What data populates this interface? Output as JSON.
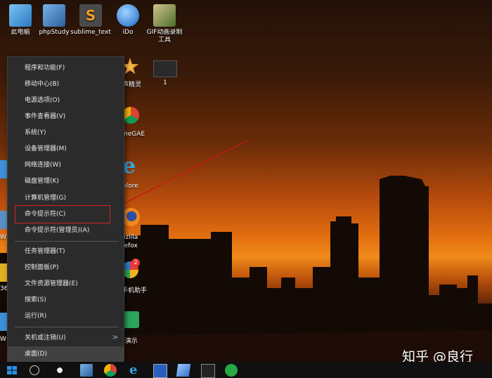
{
  "desktop": {
    "icons_top": [
      {
        "label": "此电脑",
        "color": "#3d8fd6"
      },
      {
        "label": "phpStudy",
        "color": "#3a7fc4"
      },
      {
        "label": "sublime_text",
        "color": "#444444"
      },
      {
        "label": "iDo",
        "color": "#2d7fd0"
      },
      {
        "label": "GIF动画录制",
        "label2": "工具",
        "color": "#6a8a3a"
      }
    ],
    "partial_labels": {
      "sprite": "声精灵",
      "item_1": "1",
      "chrome": "meGAE",
      "ie": "plore",
      "firefox_1": "ozilla",
      "firefox_2": "refox",
      "assistant": "手机助手",
      "demo": "0演示",
      "left_36": "36",
      "left_w1": "W",
      "left_w2": "W"
    },
    "assistant_badge": "2"
  },
  "context_menu": {
    "items": [
      {
        "label": "程序和功能(F)"
      },
      {
        "label": "移动中心(B)"
      },
      {
        "label": "电源选项(O)"
      },
      {
        "label": "事件查看器(V)"
      },
      {
        "label": "系统(Y)"
      },
      {
        "label": "设备管理器(M)"
      },
      {
        "label": "网络连接(W)"
      },
      {
        "label": "磁盘管理(K)"
      },
      {
        "label": "计算机管理(G)"
      },
      {
        "label": "命令提示符(C)"
      },
      {
        "label": "命令提示符(管理员)(A)"
      },
      {
        "label": "任务管理器(T)"
      },
      {
        "label": "控制面板(P)"
      },
      {
        "label": "文件资源管理器(E)"
      },
      {
        "label": "搜索(S)"
      },
      {
        "label": "运行(R)"
      },
      {
        "label": "关机或注销(U)",
        "submenu": ">"
      },
      {
        "label": "桌面(D)"
      }
    ]
  },
  "watermark": "知乎 @良行",
  "colors": {
    "menu_bg": "#2b2b2b",
    "highlight": "#d32020",
    "taskbar": "#101010"
  }
}
